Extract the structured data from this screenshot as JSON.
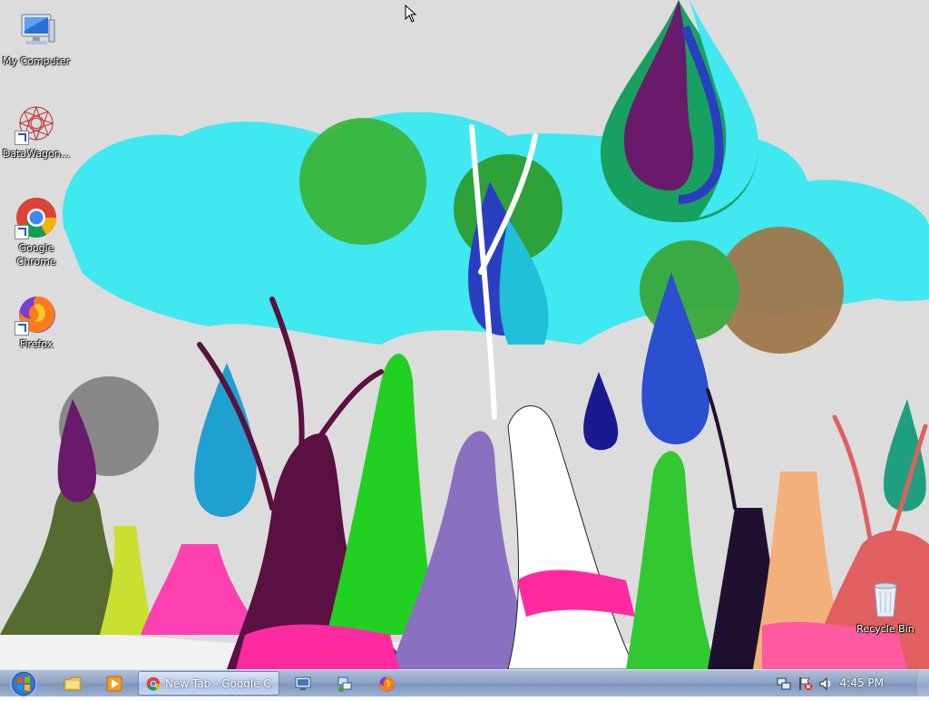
{
  "desktop": {
    "icons": [
      {
        "label": "My Computer",
        "icon": "computer-icon"
      },
      {
        "label": "DataWagon...",
        "icon": "datawagon-icon"
      },
      {
        "label": "Google\nChrome",
        "icon": "chrome-icon"
      },
      {
        "label": "Firefox",
        "icon": "firefox-icon"
      }
    ],
    "recycle_bin": {
      "label": "Recycle Bin",
      "icon": "recycle-bin-icon"
    }
  },
  "taskbar": {
    "start_icon": "windows-logo-icon",
    "pinned": [
      "file-explorer-icon",
      "media-player-icon"
    ],
    "active_task": {
      "title": "New Tab - Google C...",
      "icon": "chrome-icon"
    },
    "extra_tasks": [
      "remote-desktop-icon",
      "network-tool-icon",
      "firefox-icon"
    ],
    "tray_icons": [
      "network-icon",
      "action-center-flag-icon",
      "volume-icon"
    ],
    "clock": "4:45 PM"
  },
  "colors": {
    "taskbar_top": "#aebfd8",
    "taskbar_bottom": "#7f96bb",
    "sky_blob": "#40e8f0",
    "wallpaper_bg": "#e6e6e6"
  }
}
